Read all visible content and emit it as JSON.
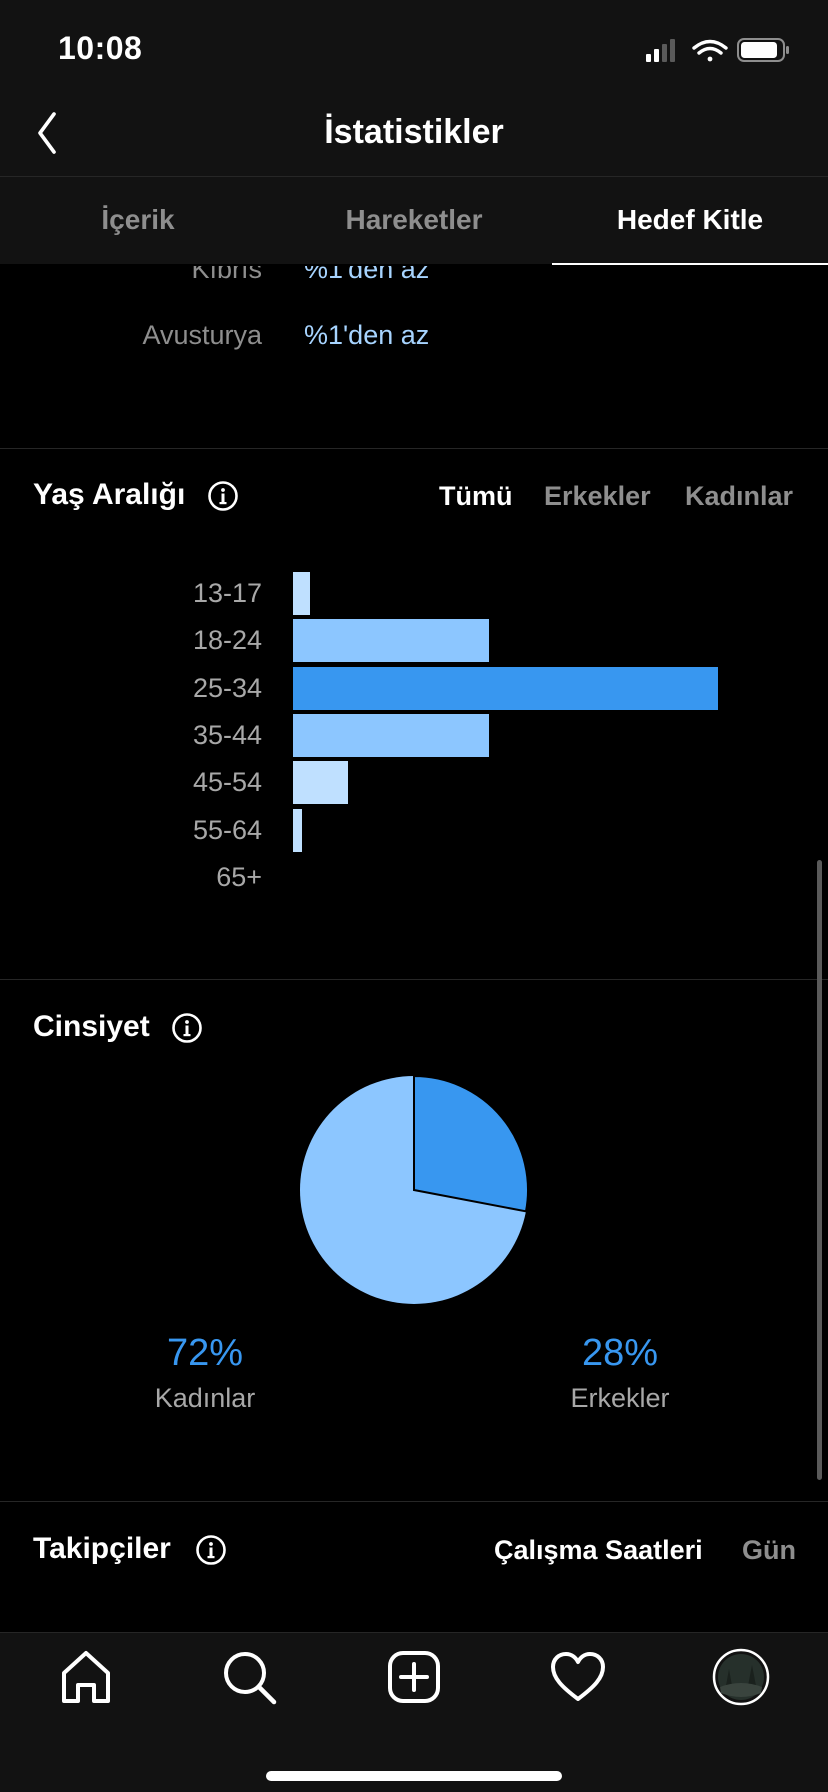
{
  "status_bar": {
    "time": "10:08"
  },
  "nav": {
    "title": "İstatistikler"
  },
  "tabs": [
    {
      "label": "İçerik",
      "active": false
    },
    {
      "label": "Hareketler",
      "active": false
    },
    {
      "label": "Hedef Kitle",
      "active": true
    }
  ],
  "countries": [
    {
      "name": "Kıbrıs",
      "value": "%1'den az"
    },
    {
      "name": "Avusturya",
      "value": "%1'den az"
    }
  ],
  "age_section": {
    "title": "Yaş Aralığı",
    "filters": [
      {
        "label": "Tümü",
        "active": true
      },
      {
        "label": "Erkekler",
        "active": false
      },
      {
        "label": "Kadınlar",
        "active": false
      }
    ]
  },
  "gender_section": {
    "title": "Cinsiyet",
    "women": {
      "pct": "72%",
      "label": "Kadınlar"
    },
    "men": {
      "pct": "28%",
      "label": "Erkekler"
    }
  },
  "followers_section": {
    "title": "Takipçiler",
    "filters": [
      {
        "label": "Çalışma Saatleri",
        "active": true
      },
      {
        "label": "Gün",
        "active": false
      }
    ]
  },
  "colors": {
    "accent": "#3897f0",
    "light_blue": "#8cc6ff",
    "pale_blue": "#bfe0ff",
    "country_value": "#a7d4ff"
  },
  "chart_data": [
    {
      "type": "bar",
      "orientation": "horizontal",
      "categories": [
        "13-17",
        "18-24",
        "25-34",
        "35-44",
        "45-54",
        "55-64",
        "65+"
      ],
      "values": [
        4,
        46,
        100,
        46,
        13,
        2,
        0
      ]
    },
    {
      "type": "pie",
      "slices": [
        {
          "label": "Kadınlar",
          "value": 72
        },
        {
          "label": "Erkekler",
          "value": 28
        }
      ]
    }
  ]
}
